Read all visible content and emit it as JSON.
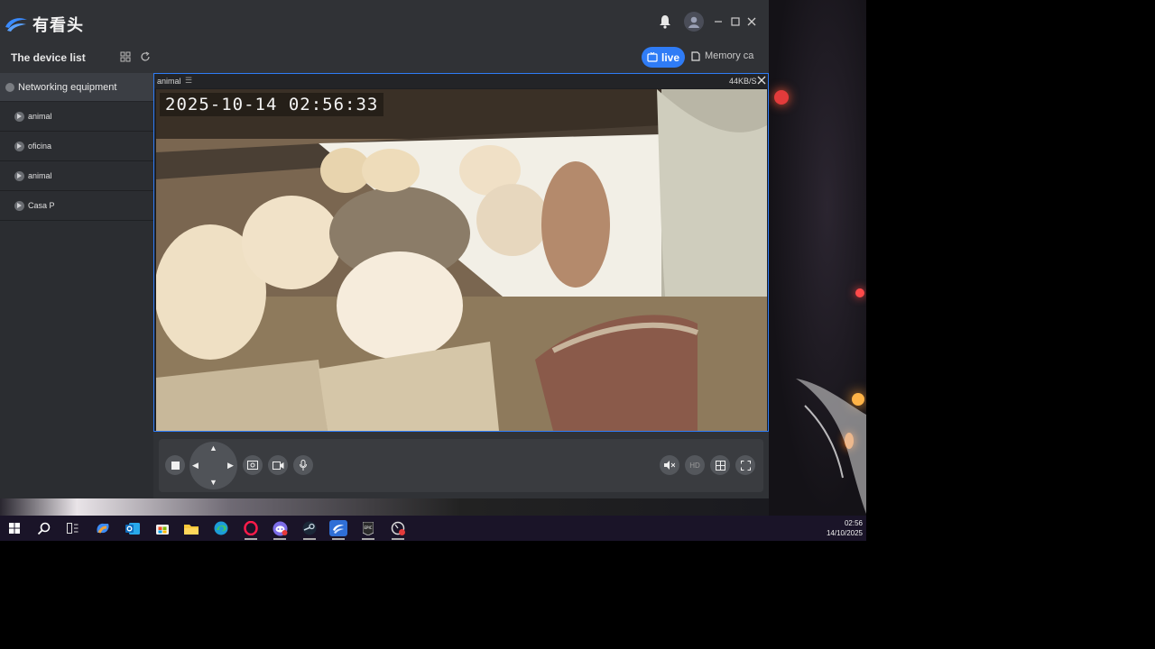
{
  "app": {
    "name": "有看头",
    "brand_color": "#2f7cf6"
  },
  "toolbar": {
    "device_list_title": "The device list",
    "live_label": "live",
    "memory_label": "Memory ca"
  },
  "sidebar": {
    "group_label": "Networking equipment",
    "items": [
      {
        "label": "animal"
      },
      {
        "label": "oficina"
      },
      {
        "label": "animal"
      },
      {
        "label": "Casa P"
      }
    ]
  },
  "video": {
    "channel_name": "animal",
    "bitrate": "44KB/S",
    "osd_datetime": "2025-10-14  02:56:33"
  },
  "controls": {
    "hd_label": "HD",
    "icons": [
      "stop-icon",
      "ptz-dpad-icon",
      "snapshot-icon",
      "record-icon",
      "microphone-icon",
      "mute-icon",
      "hd-icon",
      "grid-layout-icon",
      "fullscreen-icon"
    ]
  },
  "taskbar": {
    "time": "02:56",
    "date": "14/10/2025",
    "apps": [
      "windows-start-icon",
      "search-icon",
      "task-view-icon",
      "copilot-icon",
      "outlook-icon",
      "store-icon",
      "file-explorer-icon",
      "edge-icon",
      "opera-icon",
      "discord-icon",
      "steam-icon",
      "camera-app-icon",
      "epic-games-icon",
      "recorder-icon"
    ]
  }
}
